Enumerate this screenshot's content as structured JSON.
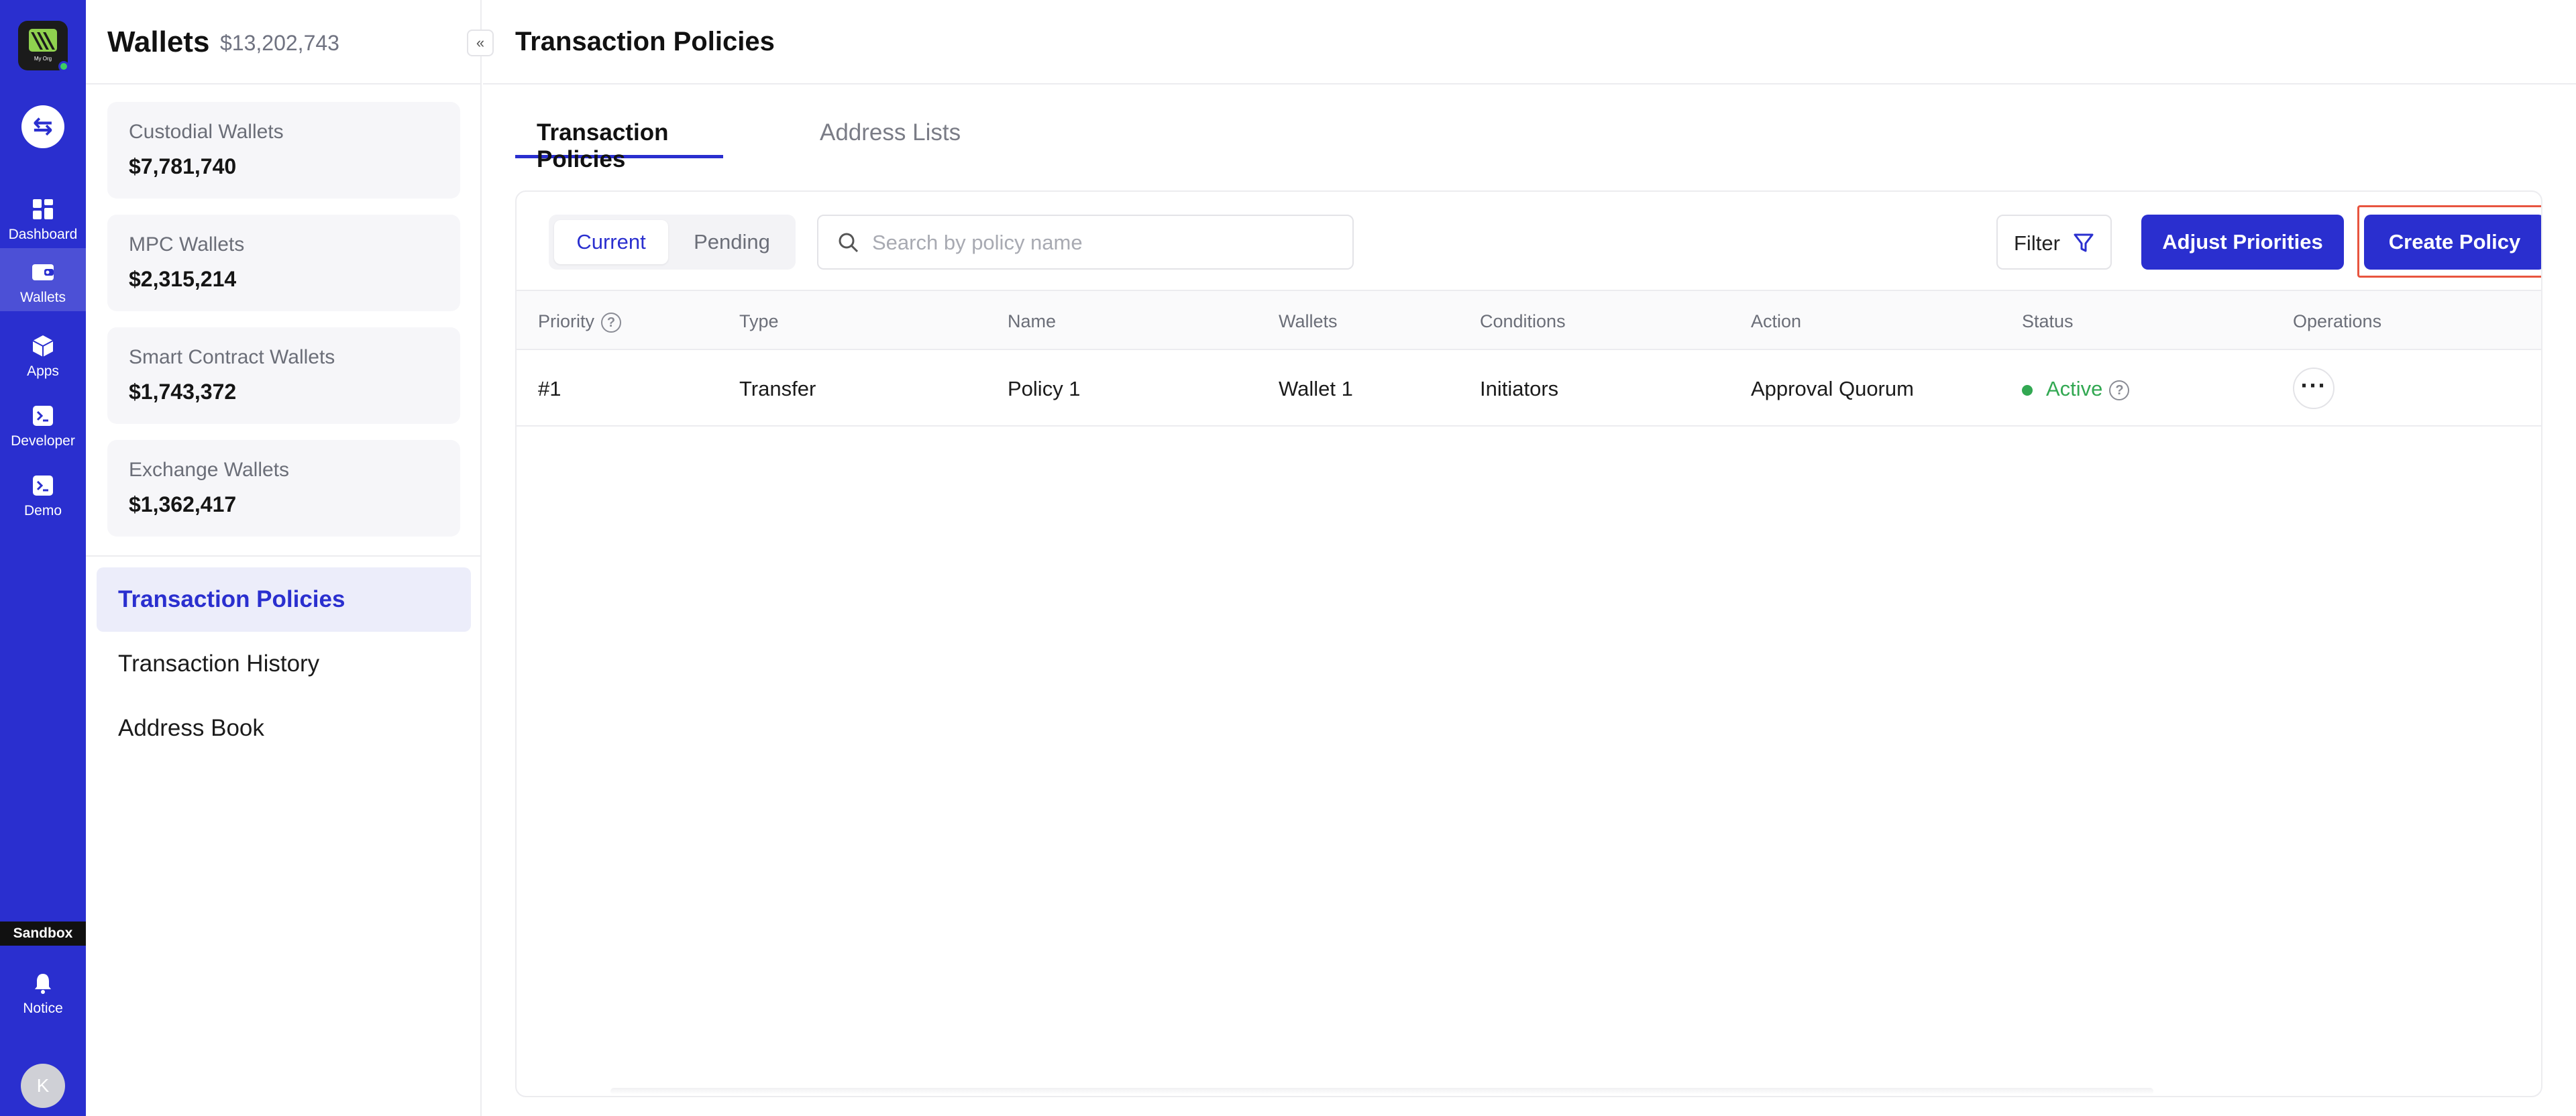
{
  "rail": {
    "logo_org": "My Org",
    "nav": [
      {
        "label": "Dashboard",
        "icon": "dashboard-icon"
      },
      {
        "label": "Wallets",
        "icon": "wallet-icon"
      },
      {
        "label": "Apps",
        "icon": "cube-icon"
      },
      {
        "label": "Developer",
        "icon": "terminal-icon"
      },
      {
        "label": "Demo",
        "icon": "terminal-icon"
      }
    ],
    "sandbox": "Sandbox",
    "notice": "Notice",
    "avatar_initial": "K"
  },
  "sidebar": {
    "title": "Wallets",
    "total": "$13,202,743",
    "collapse_glyph": "«",
    "wallets": [
      {
        "name": "Custodial Wallets",
        "value": "$7,781,740"
      },
      {
        "name": "MPC Wallets",
        "value": "$2,315,214"
      },
      {
        "name": "Smart Contract Wallets",
        "value": "$1,743,372"
      },
      {
        "name": "Exchange Wallets",
        "value": "$1,362,417"
      }
    ],
    "links": [
      {
        "label": "Transaction Policies",
        "active": true
      },
      {
        "label": "Transaction History",
        "active": false
      },
      {
        "label": "Address Book",
        "active": false
      }
    ]
  },
  "main": {
    "title": "Transaction Policies",
    "tabs": [
      "Transaction Policies",
      "Address Lists"
    ],
    "segment": [
      "Current",
      "Pending"
    ],
    "search_placeholder": "Search by policy name",
    "filter_label": "Filter",
    "adjust_label": "Adjust Priorities",
    "create_label": "Create Policy",
    "columns": [
      "Priority",
      "Type",
      "Name",
      "Wallets",
      "Conditions",
      "Action",
      "Status",
      "Operations"
    ],
    "rows": [
      {
        "priority": "#1",
        "type": "Transfer",
        "name": "Policy 1",
        "wallets": "Wallet 1",
        "conditions": "Initiators",
        "action": "Approval Quorum",
        "status": "Active"
      }
    ],
    "more_glyph": "···"
  },
  "colors": {
    "brand": "#2a2fcf",
    "active_status": "#32a852",
    "highlight": "#e8553f"
  }
}
